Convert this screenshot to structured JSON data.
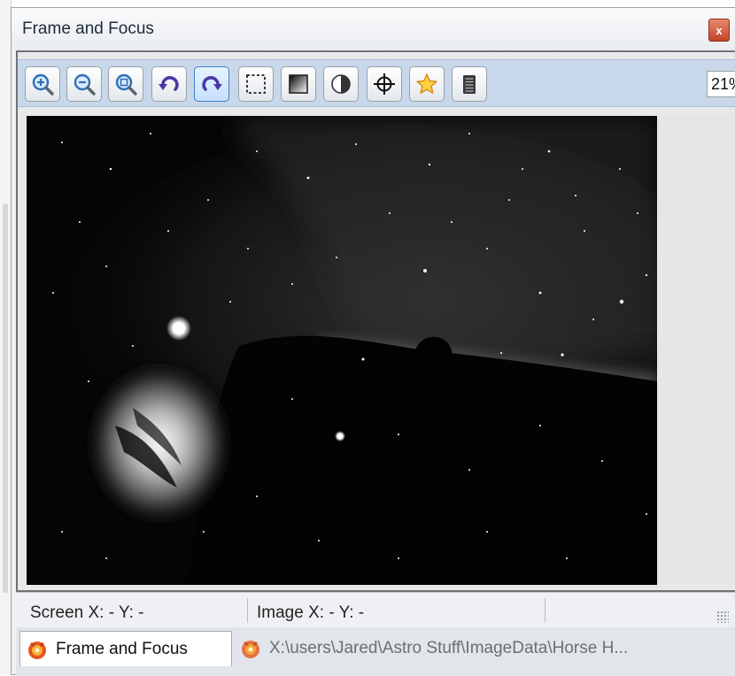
{
  "window": {
    "title": "Frame and Focus",
    "close_label": "x"
  },
  "toolbar": {
    "buttons": [
      {
        "icon": "zoom-in-icon"
      },
      {
        "icon": "zoom-out-icon"
      },
      {
        "icon": "zoom-fit-icon"
      },
      {
        "icon": "rotate-left-icon"
      },
      {
        "icon": "rotate-right-icon",
        "active": true
      },
      {
        "icon": "selection-rect-icon"
      },
      {
        "icon": "gradient-stretch-icon"
      },
      {
        "icon": "contrast-icon"
      },
      {
        "icon": "crosshair-icon"
      },
      {
        "icon": "star-icon"
      },
      {
        "icon": "histogram-icon"
      }
    ],
    "zoom_value": "21%"
  },
  "status": {
    "screen": "Screen X: - Y: -",
    "image": "Image X: - Y: -"
  },
  "tabs": [
    {
      "label": "Frame and Focus",
      "active": true
    },
    {
      "label": "X:\\users\\Jared\\Astro Stuff\\ImageData\\Horse H...",
      "active": false
    }
  ],
  "colors": {
    "toolbar_bg": "#c8d8ea",
    "active_button_border": "#3d7ec7",
    "close_button": "#c4432a"
  }
}
